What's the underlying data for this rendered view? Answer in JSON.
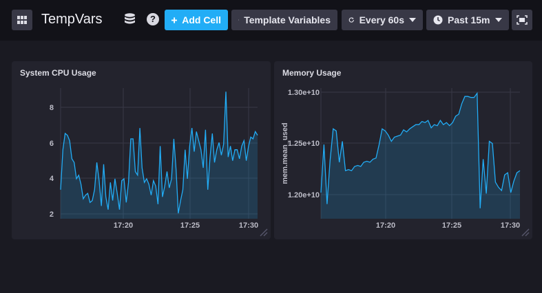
{
  "header": {
    "title": "TempVars",
    "add_cell_label": "Add Cell",
    "template_variables_label": "Template Variables",
    "refresh_label": "Every 60s",
    "time_range_label": "Past 15m"
  },
  "colors": {
    "accent": "#22adf6",
    "line": "#22adf6",
    "fill": "#22adf6"
  },
  "icons": [
    "dashboards-icon",
    "database-icon",
    "help-icon",
    "plus-icon",
    "cube-icon",
    "refresh-icon",
    "clock-icon",
    "chevron-down-icon",
    "fullscreen-icon",
    "resize-icon"
  ],
  "cells": [
    {
      "title": "System CPU Usage"
    },
    {
      "title": "Memory Usage"
    }
  ],
  "chart_data": [
    {
      "type": "area",
      "title": "System CPU Usage",
      "ylabel": "",
      "xlabel": "",
      "x_ticks": [
        "17:20",
        "17:25",
        "17:30"
      ],
      "y_ticks": [
        "2",
        "4",
        "6",
        "8"
      ],
      "ylim": [
        1.8,
        9.0
      ],
      "grid": true,
      "series": [
        {
          "values": [
            3.4,
            5.6,
            6.5,
            6.4,
            6.1,
            5.1,
            4.9,
            4.0,
            4.2,
            3.7,
            2.9,
            3.1,
            3.2,
            2.7,
            2.8,
            3.4,
            4.9,
            3.9,
            2.5,
            4.8,
            3.0,
            2.3,
            3.8,
            2.8,
            4.0,
            3.2,
            2.3,
            3.9,
            4.0,
            2.7,
            3.8,
            6.2,
            6.2,
            4.4,
            4.2,
            6.8,
            4.6,
            3.8,
            4.0,
            3.7,
            3.1,
            3.9,
            3.6,
            2.6,
            5.8,
            3.0,
            3.6,
            4.4,
            3.5,
            4.0,
            6.2,
            4.5,
            2.1,
            2.8,
            3.4,
            5.6,
            4.0,
            5.8,
            6.8,
            5.5,
            6.6,
            6.1,
            5.6,
            4.6,
            6.7,
            3.4,
            5.2,
            6.5,
            4.9,
            5.6,
            6.0,
            5.3,
            5.9,
            8.8,
            5.2,
            5.8,
            5.0,
            5.6,
            5.6,
            5.1,
            5.8,
            6.1,
            5.0,
            5.8,
            6.3,
            6.2,
            6.6,
            6.4
          ]
        }
      ]
    },
    {
      "type": "area",
      "title": "Memory Usage",
      "ylabel": "mem.mean_used",
      "xlabel": "",
      "x_ticks": [
        "17:20",
        "17:25",
        "17:30"
      ],
      "y_ticks": [
        "1.20e+10",
        "1.25e+10",
        "1.30e+10"
      ],
      "ylim": [
        11.76,
        13.01
      ],
      "grid": true,
      "series": [
        {
          "values": [
            12.01,
            12.47,
            11.9,
            12.32,
            12.62,
            12.6,
            12.3,
            12.5,
            12.22,
            12.23,
            12.22,
            12.26,
            12.27,
            12.26,
            12.3,
            12.31,
            12.3,
            12.33,
            12.34,
            12.47,
            12.62,
            12.6,
            12.56,
            12.5,
            12.54,
            12.55,
            12.56,
            12.61,
            12.59,
            12.62,
            12.64,
            12.66,
            12.66,
            12.69,
            12.68,
            12.7,
            12.63,
            12.66,
            12.65,
            12.7,
            12.66,
            12.68,
            12.65,
            12.68,
            12.74,
            12.76,
            12.86,
            12.93,
            12.93,
            12.92,
            12.92,
            12.96,
            11.86,
            12.33,
            12.0,
            12.5,
            12.48,
            12.11,
            12.06,
            12.03,
            12.18,
            12.2,
            12.01,
            12.12,
            12.2,
            12.22
          ]
        }
      ]
    }
  ]
}
